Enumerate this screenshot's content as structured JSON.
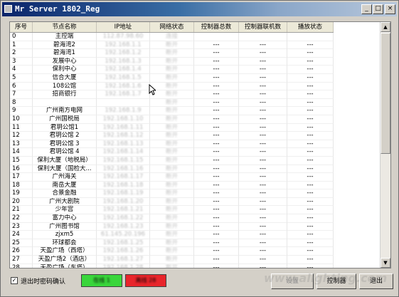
{
  "window": {
    "title": "Mr Server 1802_Reg",
    "controls": {
      "minimize": "_",
      "maximize": "□",
      "close": "×"
    }
  },
  "columns": [
    "序号",
    "节点名称",
    "IP地址",
    "网络状态",
    "控制器总数",
    "控制器联机数",
    "播放状态"
  ],
  "rows": [
    {
      "id": "0",
      "name": "主控端",
      "ip": "112.87.98.60",
      "net": "连接",
      "c1": "",
      "c2": "",
      "c3": ""
    },
    {
      "id": "1",
      "name": "碧海湾2",
      "ip": "192.168.1.1",
      "net": "断开",
      "c1": "---",
      "c2": "---",
      "c3": "---"
    },
    {
      "id": "2",
      "name": "碧海湾1",
      "ip": "192.168.1.2",
      "net": "断开",
      "c1": "---",
      "c2": "---",
      "c3": "---"
    },
    {
      "id": "3",
      "name": "发展中心",
      "ip": "192.168.1.3",
      "net": "断开",
      "c1": "---",
      "c2": "---",
      "c3": "---"
    },
    {
      "id": "4",
      "name": "保利中心",
      "ip": "192.168.1.4",
      "net": "断开",
      "c1": "---",
      "c2": "---",
      "c3": "---"
    },
    {
      "id": "5",
      "name": "信合大厦",
      "ip": "192.168.1.5",
      "net": "断开",
      "c1": "---",
      "c2": "---",
      "c3": "---"
    },
    {
      "id": "6",
      "name": "108公馆",
      "ip": "192.168.1.6",
      "net": "断开",
      "c1": "---",
      "c2": "---",
      "c3": "---"
    },
    {
      "id": "7",
      "name": "招商银行",
      "ip": "192.168.1.7",
      "net": "断开",
      "c1": "---",
      "c2": "---",
      "c3": "---"
    },
    {
      "id": "8",
      "name": "",
      "ip": "",
      "net": "断开",
      "c1": "---",
      "c2": "---",
      "c3": "---"
    },
    {
      "id": "9",
      "name": "广州南方电网",
      "ip": "192.168.1.9",
      "net": "断开",
      "c1": "---",
      "c2": "---",
      "c3": "---"
    },
    {
      "id": "10",
      "name": "广州国税局",
      "ip": "192.168.1.10",
      "net": "断开",
      "c1": "---",
      "c2": "---",
      "c3": "---"
    },
    {
      "id": "11",
      "name": "君玥公馆1",
      "ip": "192.168.1.11",
      "net": "断开",
      "c1": "---",
      "c2": "---",
      "c3": "---"
    },
    {
      "id": "12",
      "name": "君玥公馆 2",
      "ip": "192.168.1.12",
      "net": "断开",
      "c1": "---",
      "c2": "---",
      "c3": "---"
    },
    {
      "id": "13",
      "name": "君玥公馆 3",
      "ip": "192.168.1.13",
      "net": "断开",
      "c1": "---",
      "c2": "---",
      "c3": "---"
    },
    {
      "id": "14",
      "name": "君玥公馆 4",
      "ip": "192.168.1.14",
      "net": "断开",
      "c1": "---",
      "c2": "---",
      "c3": "---"
    },
    {
      "id": "15",
      "name": "保利大厦（地税局）",
      "ip": "192.168.1.15",
      "net": "断开",
      "c1": "---",
      "c2": "---",
      "c3": "---"
    },
    {
      "id": "16",
      "name": "保利大厦（国检大...",
      "ip": "192.168.1.16",
      "net": "断开",
      "c1": "---",
      "c2": "---",
      "c3": "---"
    },
    {
      "id": "17",
      "name": "广州海关",
      "ip": "192.168.1.17",
      "net": "断开",
      "c1": "---",
      "c2": "---",
      "c3": "---"
    },
    {
      "id": "18",
      "name": "南岳大厦",
      "ip": "192.168.1.18",
      "net": "断开",
      "c1": "---",
      "c2": "---",
      "c3": "---"
    },
    {
      "id": "19",
      "name": "合景金融",
      "ip": "192.168.1.19",
      "net": "断开",
      "c1": "---",
      "c2": "---",
      "c3": "---"
    },
    {
      "id": "20",
      "name": "广州大剧院",
      "ip": "192.168.1.20",
      "net": "断开",
      "c1": "---",
      "c2": "---",
      "c3": "---"
    },
    {
      "id": "21",
      "name": "少年宫",
      "ip": "192.168.1.21",
      "net": "断开",
      "c1": "---",
      "c2": "---",
      "c3": "---"
    },
    {
      "id": "22",
      "name": "富力中心",
      "ip": "192.168.1.22",
      "net": "断开",
      "c1": "---",
      "c2": "---",
      "c3": "---"
    },
    {
      "id": "23",
      "name": "广州图书馆",
      "ip": "192.168.1.23",
      "net": "断开",
      "c1": "---",
      "c2": "---",
      "c3": "---"
    },
    {
      "id": "24",
      "name": "zjxm5",
      "ip": "61.145.20.196",
      "net": "断开",
      "c1": "---",
      "c2": "---",
      "c3": "---"
    },
    {
      "id": "25",
      "name": "环球都会",
      "ip": "192.168.1.25",
      "net": "断开",
      "c1": "---",
      "c2": "---",
      "c3": "---"
    },
    {
      "id": "26",
      "name": "天盈广场（西塔）",
      "ip": "192.168.1.26",
      "net": "断开",
      "c1": "---",
      "c2": "---",
      "c3": "---"
    },
    {
      "id": "27",
      "name": "天盈广场2（酒店）",
      "ip": "192.168.1.27",
      "net": "断开",
      "c1": "---",
      "c2": "---",
      "c3": "---"
    },
    {
      "id": "28",
      "name": "天盈广场（东塔）",
      "ip": "192.168.1.28",
      "net": "断开",
      "c1": "---",
      "c2": "---",
      "c3": "---"
    }
  ],
  "footer": {
    "exit_confirm_label": "退出时密码确认",
    "exit_confirm_checked": true,
    "status_online": "在线 1",
    "status_offline": "离线 28",
    "settings_button": "设置",
    "controller_button": "控制器",
    "exit_button": "退出"
  },
  "watermark": "www.alighting.com",
  "colors": {
    "online": "#39d63b",
    "offline": "#e8252b",
    "title_start": "#0a246a",
    "title_end": "#b8c8dc"
  }
}
